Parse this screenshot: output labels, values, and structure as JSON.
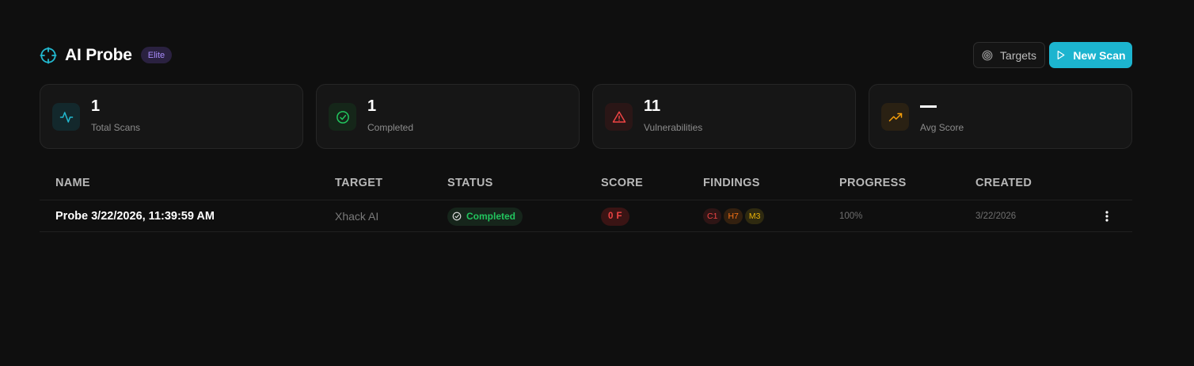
{
  "header": {
    "title": "AI Probe",
    "tier_badge": "Elite",
    "targets_label": "Targets",
    "new_scan_label": "New Scan"
  },
  "stats": [
    {
      "value": "1",
      "label": "Total Scans",
      "icon": "activity-icon",
      "color": "#22b8cf"
    },
    {
      "value": "1",
      "label": "Completed",
      "icon": "check-circle-icon",
      "color": "#22c55e"
    },
    {
      "value": "11",
      "label": "Vulnerabilities",
      "icon": "alert-triangle-icon",
      "color": "#ef4444"
    },
    {
      "value": "",
      "label": "Avg Score",
      "icon": "trending-up-icon",
      "color": "#f59e0b"
    }
  ],
  "table": {
    "columns": [
      "NAME",
      "TARGET",
      "STATUS",
      "SCORE",
      "FINDINGS",
      "PROGRESS",
      "CREATED"
    ],
    "rows": [
      {
        "name": "Probe 3/22/2026, 11:39:59 AM",
        "target": "Xhack AI",
        "status": "Completed",
        "score": "0 F",
        "findings": {
          "critical": "C1",
          "high": "H7",
          "medium": "M3"
        },
        "progress": "100%",
        "created": "3/22/2026"
      }
    ]
  },
  "colors": {
    "accent": "#1cb4cf",
    "background": "#0f0f0f",
    "success": "#22c55e",
    "danger": "#ef4444",
    "warning": "#f59e0b"
  }
}
